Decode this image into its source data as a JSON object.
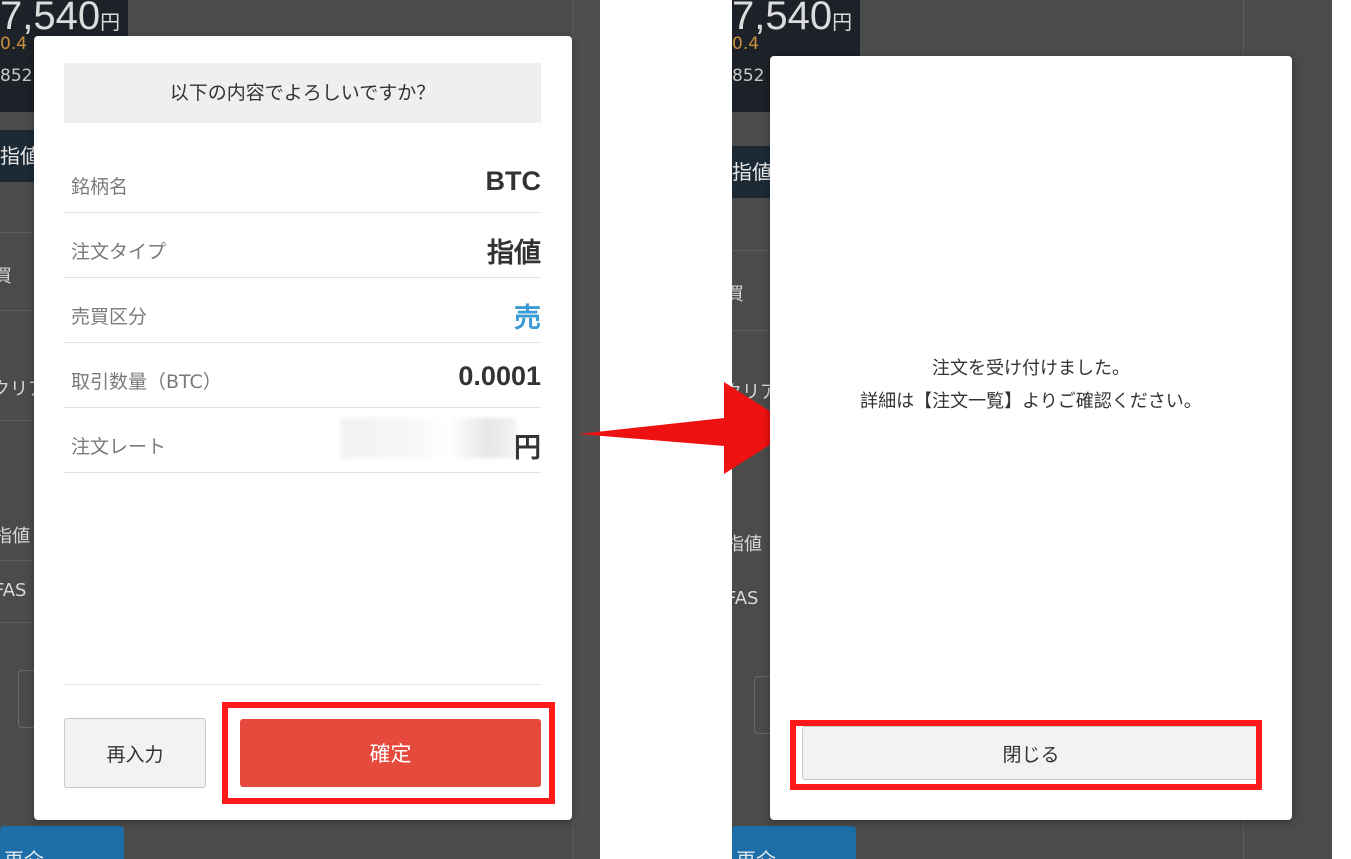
{
  "background": {
    "price": "7,540",
    "price_unit": "円",
    "change": "0.4",
    "sub_value": "852",
    "tab_limit": "指値",
    "side_text": "買",
    "clear_text": "クリア",
    "limit_text": "指値",
    "fas_text": "FAS",
    "bottom_button": "再介"
  },
  "confirm_dialog": {
    "header": "以下の内容でよろしいですか？",
    "rows": [
      {
        "label": "銘柄名",
        "value": "BTC"
      },
      {
        "label": "注文タイプ",
        "value": "指値"
      },
      {
        "label": "売買区分",
        "value": "売"
      },
      {
        "label": "取引数量（BTC）",
        "value": "0.0001"
      },
      {
        "label": "注文レート",
        "value": "円"
      }
    ],
    "reenter_button": "再入力",
    "confirm_button": "確定"
  },
  "done_dialog": {
    "message_line1": "注文を受け付けました。",
    "message_line2": "詳細は【注文一覧】よりご確認ください。",
    "close_button": "閉じる"
  },
  "colors": {
    "confirm_button": "#e64a3c",
    "sell_value": "#3c9ad6",
    "highlight": "#ff1a1a",
    "overlay": "#4b4b4b"
  }
}
